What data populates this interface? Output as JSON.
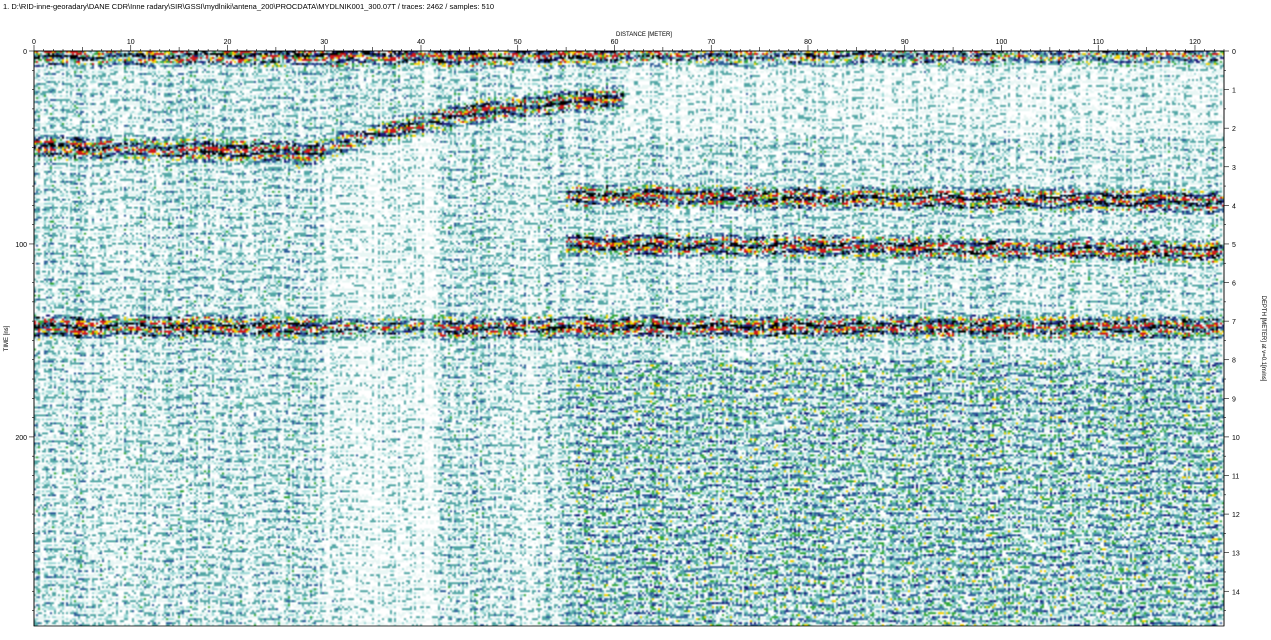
{
  "header": {
    "file_info": "1. D:\\RID-inne-georadary\\DANE CDR\\Inne radary\\SIR\\GSSI\\mydlniki\\antena_200\\PROCDATA\\MYDLNIK001_300.07T / traces: 2462 / samples: 510"
  },
  "chart_data": {
    "type": "heatmap",
    "title": "",
    "xlabel": "DISTANCE [METER]",
    "ylabel_left": "TIME [ns]",
    "ylabel_right": "DEPTH [METER] at v=0.1[m/ns]",
    "traces": 2462,
    "samples": 510,
    "xlim": [
      0,
      123
    ],
    "ylim_time": [
      0,
      298
    ],
    "ylim_depth": [
      0,
      14.9
    ],
    "x_ticks": [
      0,
      10,
      20,
      30,
      40,
      50,
      60,
      70,
      80,
      90,
      100,
      110,
      120
    ],
    "time_ticks": [
      0,
      100,
      200
    ],
    "depth_ticks": [
      0,
      1,
      2,
      3,
      4,
      5,
      6,
      7,
      8,
      9,
      10,
      11,
      12,
      13,
      14
    ],
    "palette": [
      "#ffffff",
      "#e8f6f4",
      "#9ed8d6",
      "#54a7a6",
      "#2f5f9a",
      "#1b1b7a",
      "#000000",
      "#d01818",
      "#f4d000",
      "#33a83c"
    ],
    "reflectors": [
      {
        "name_hint": "surface",
        "x": [
          0,
          123
        ],
        "time": [
          2,
          2
        ]
      },
      {
        "name_hint": "rising-layer",
        "x": [
          27,
          35,
          45,
          55,
          61
        ],
        "time": [
          55,
          44,
          32,
          26,
          24
        ]
      },
      {
        "name_hint": "upper-left",
        "x": [
          0,
          27
        ],
        "time": [
          50,
          52
        ]
      },
      {
        "name_hint": "mid-band-1",
        "x": [
          55,
          123
        ],
        "time": [
          75,
          78
        ]
      },
      {
        "name_hint": "mid-band-2",
        "x": [
          55,
          123
        ],
        "time": [
          100,
          104
        ]
      },
      {
        "name_hint": "mid-band-3",
        "x": [
          0,
          123
        ],
        "time": [
          143,
          143
        ]
      }
    ]
  }
}
